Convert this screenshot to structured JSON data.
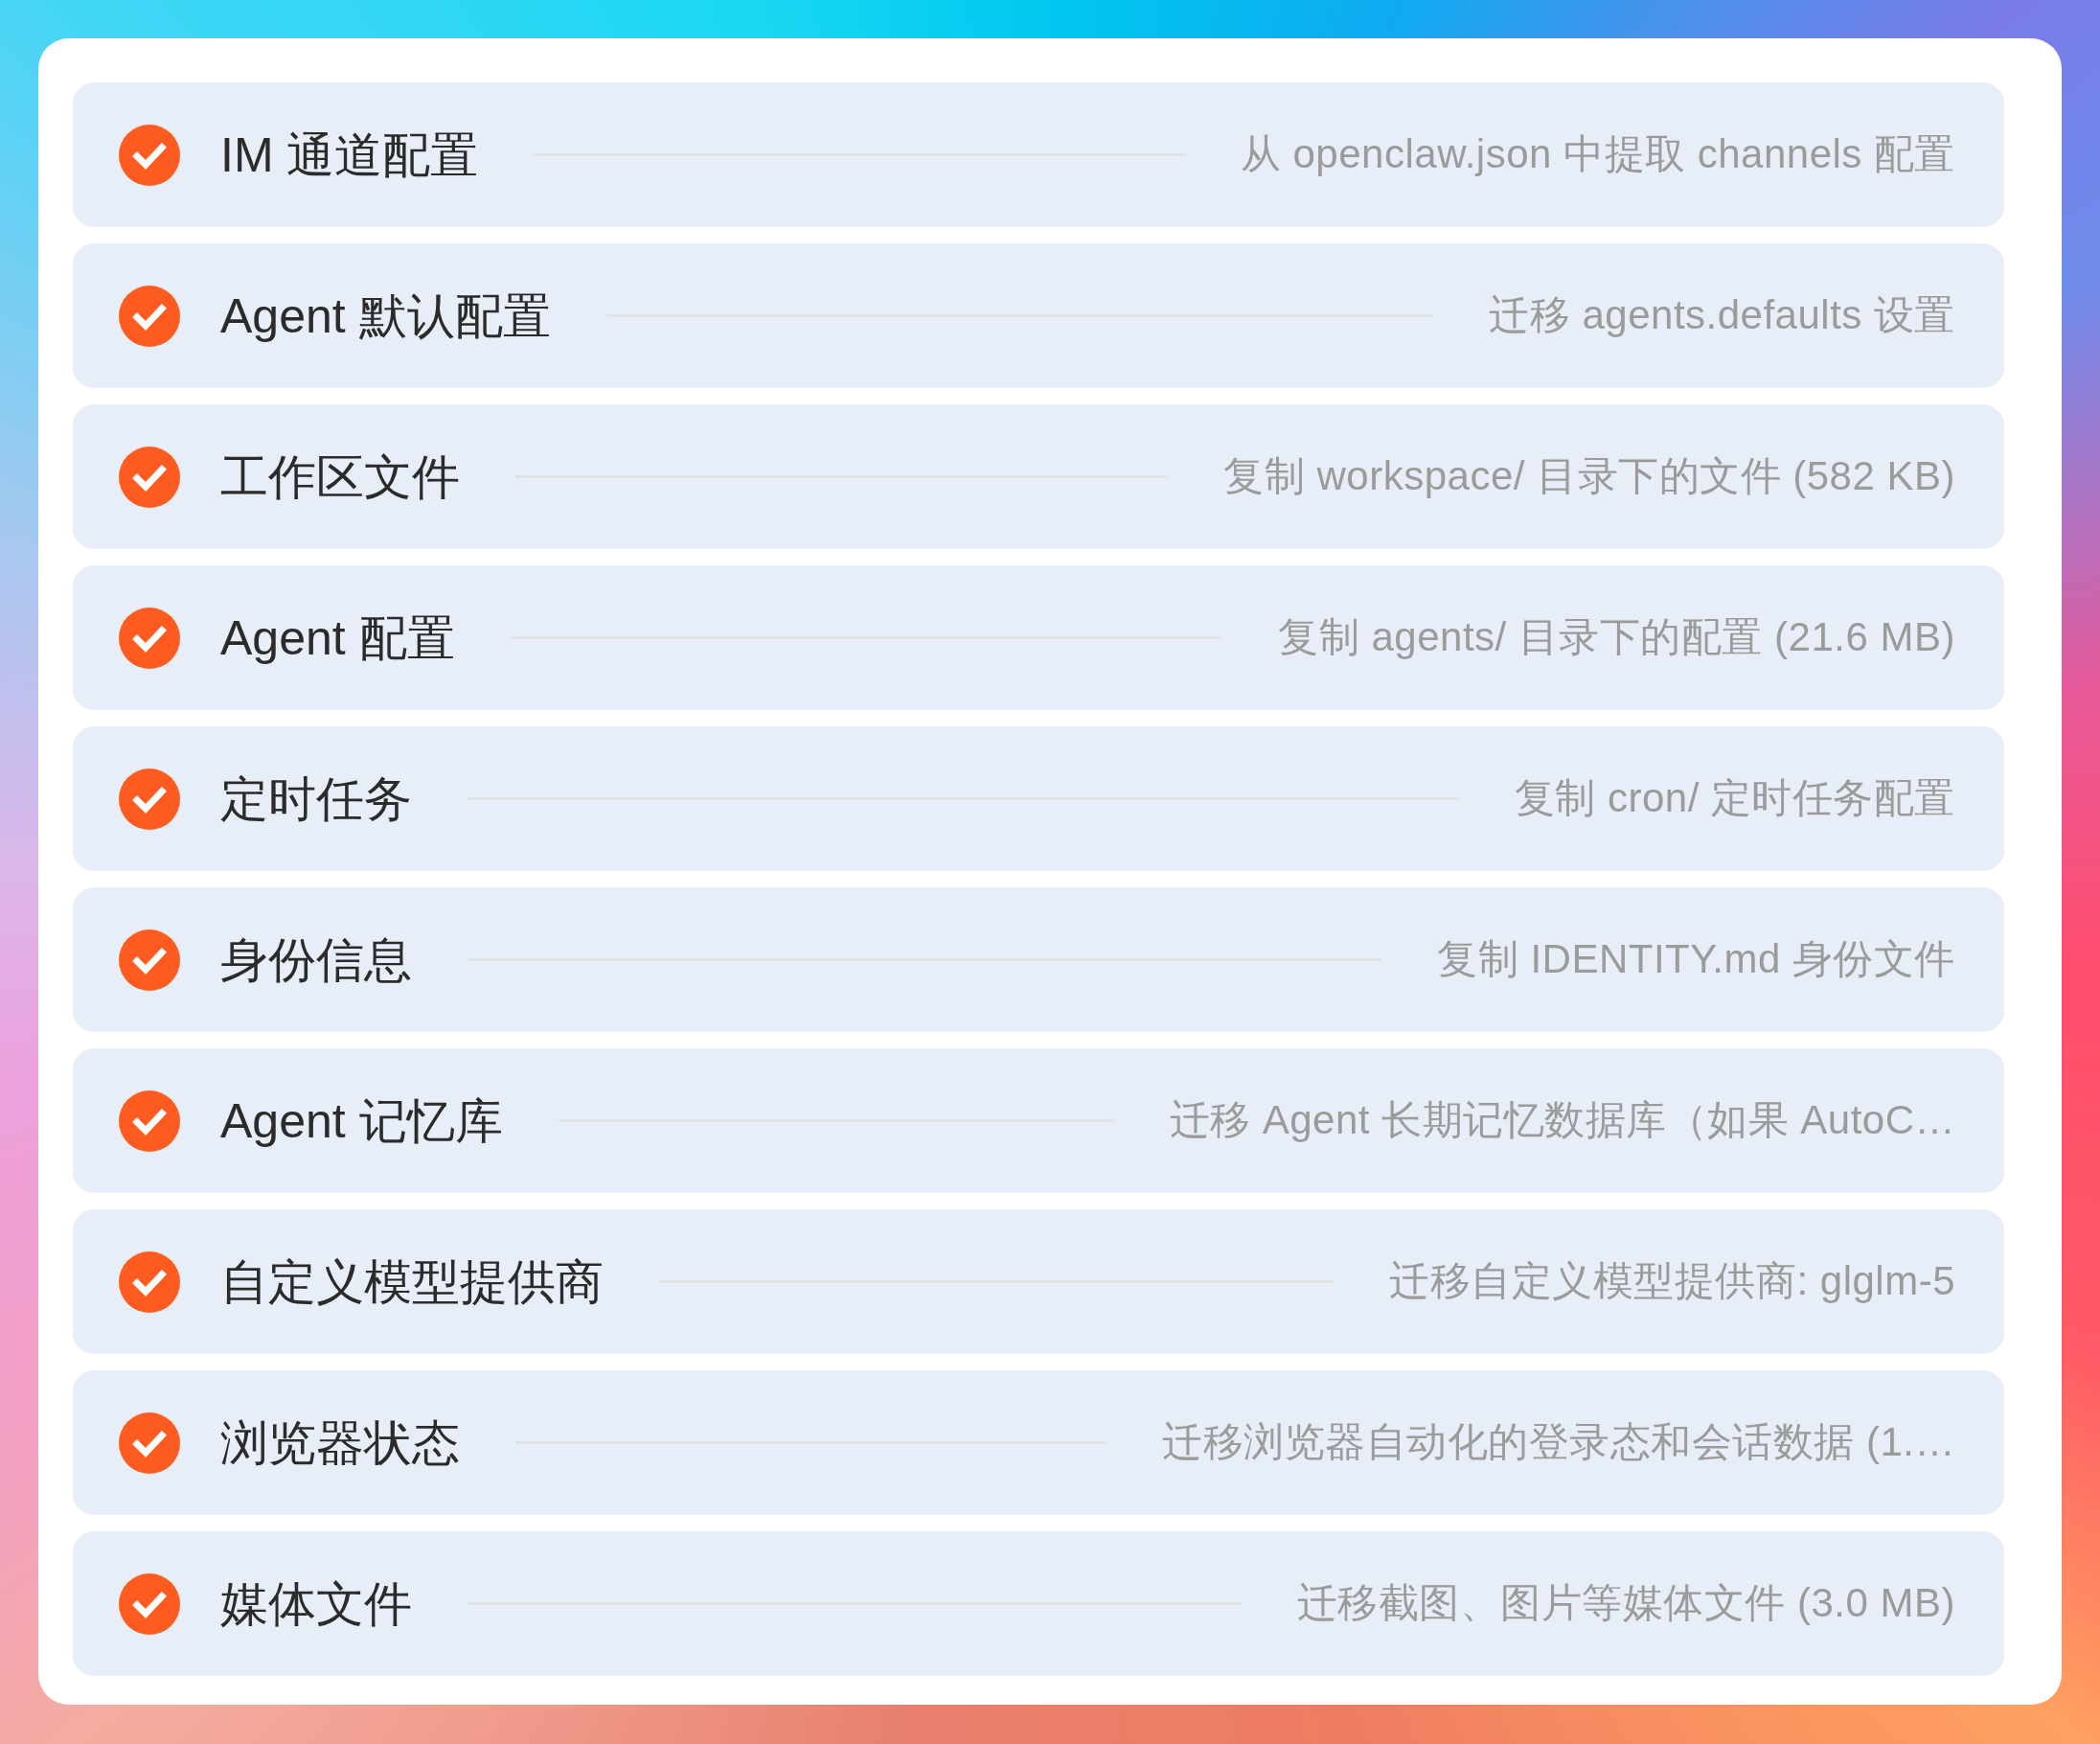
{
  "items": [
    {
      "title": "IM 通道配置",
      "description": "从 openclaw.json 中提取 channels 配置",
      "checked": true
    },
    {
      "title": "Agent 默认配置",
      "description": "迁移 agents.defaults 设置",
      "checked": true
    },
    {
      "title": "工作区文件",
      "description": "复制 workspace/ 目录下的文件 (582 KB)",
      "checked": true
    },
    {
      "title": "Agent 配置",
      "description": "复制 agents/ 目录下的配置 (21.6 MB)",
      "checked": true
    },
    {
      "title": "定时任务",
      "description": "复制 cron/ 定时任务配置",
      "checked": true
    },
    {
      "title": "身份信息",
      "description": "复制 IDENTITY.md 身份文件",
      "checked": true
    },
    {
      "title": "Agent 记忆库",
      "description": "迁移 Agent 长期记忆数据库（如果 AutoC…",
      "checked": true
    },
    {
      "title": "自定义模型提供商",
      "description": "迁移自定义模型提供商: glglm-5",
      "checked": true
    },
    {
      "title": "浏览器状态",
      "description": "迁移浏览器自动化的登录态和会话数据 (1.…",
      "checked": true
    },
    {
      "title": "媒体文件",
      "description": "迁移截图、图片等媒体文件 (3.0 MB)",
      "checked": true
    }
  ]
}
